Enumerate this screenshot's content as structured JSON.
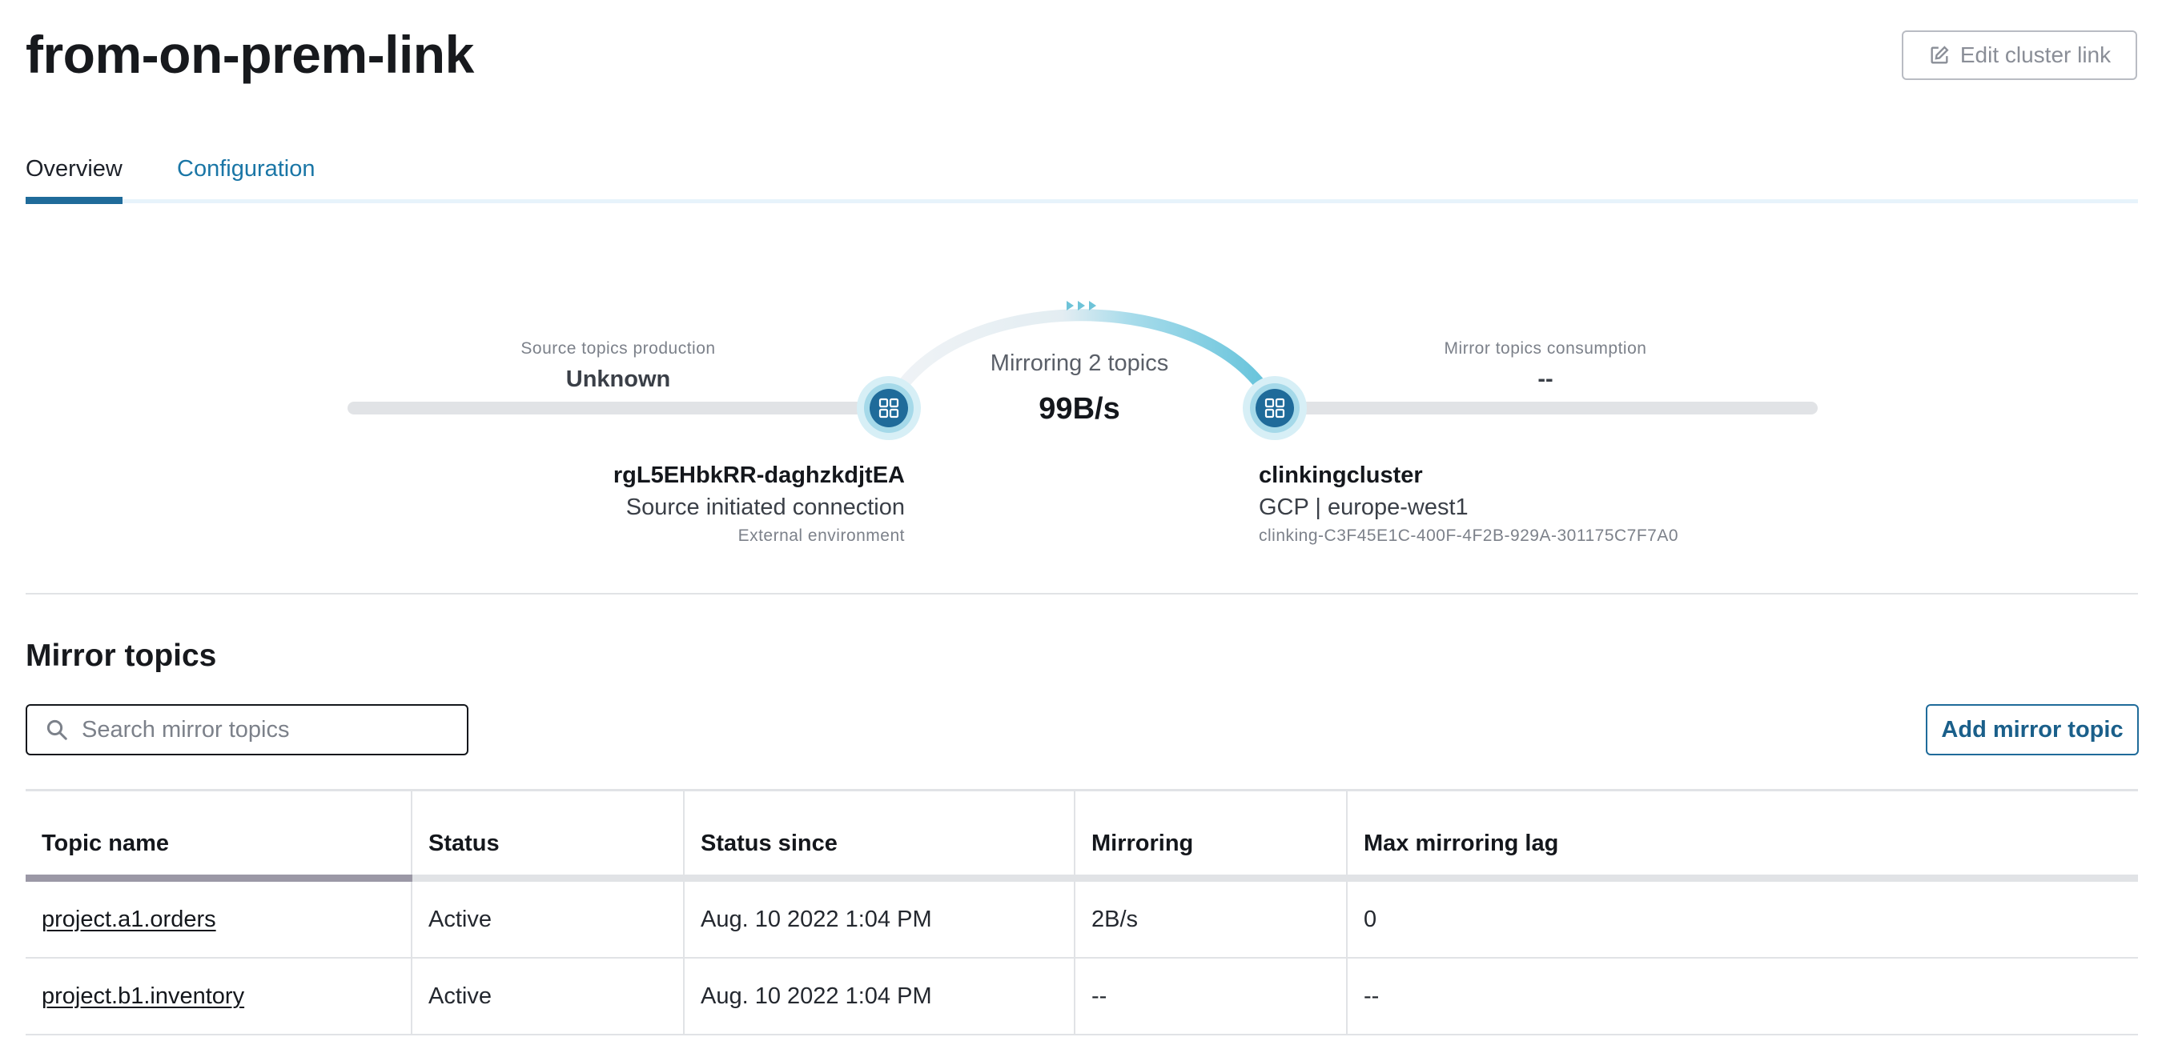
{
  "header": {
    "title": "from-on-prem-link",
    "edit_button_label": "Edit cluster link",
    "edit_icon": "edit-icon"
  },
  "tabs": [
    {
      "label": "Overview",
      "active": true
    },
    {
      "label": "Configuration",
      "active": false
    }
  ],
  "link_overview": {
    "source_production_label": "Source topics production",
    "source_production_value": "Unknown",
    "mirroring_label": "Mirroring 2 topics",
    "mirroring_rate": "99B/s",
    "mirror_consumption_label": "Mirror topics consumption",
    "mirror_consumption_value": "--",
    "source": {
      "name": "rgL5EHbkRR-daghzkdjtEA",
      "connection": "Source initiated connection",
      "environment": "External environment",
      "icon": "cluster-icon"
    },
    "destination": {
      "name": "clinkingcluster",
      "location": "GCP | europe-west1",
      "id": "clinking-C3F45E1C-400F-4F2B-929A-301175C7F7A0",
      "icon": "cluster-icon"
    },
    "colors": {
      "accent": "#1f6b9a",
      "flow": "#7fcfe2",
      "bar": "#e1e3e6"
    }
  },
  "mirror_topics": {
    "title": "Mirror topics",
    "search_placeholder": "Search mirror topics",
    "search_icon": "search-icon",
    "add_button_label": "Add mirror topic",
    "columns": [
      "Topic name",
      "Status",
      "Status since",
      "Mirroring",
      "Max mirroring lag"
    ],
    "rows": [
      {
        "topic": "project.a1.orders",
        "status": "Active",
        "since": "Aug. 10 2022 1:04 PM",
        "mirroring": "2B/s",
        "lag": "0"
      },
      {
        "topic": "project.b1.inventory",
        "status": "Active",
        "since": "Aug. 10 2022 1:04 PM",
        "mirroring": "--",
        "lag": "--"
      }
    ]
  }
}
